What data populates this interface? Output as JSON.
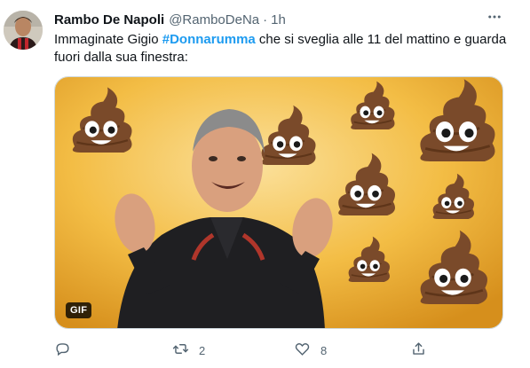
{
  "tweet": {
    "author_name": "Rambo De Napoli",
    "handle": "@RamboDeNa",
    "separator": "·",
    "time": "1h",
    "text_part1": "Immaginate Gigio ",
    "hashtag": "#Donnarumma",
    "text_part2": " che si sveglia alle 11 del mattino e guarda fuori dalla sua finestra:",
    "media_badge": "GIF"
  },
  "actions": {
    "reply_count": "",
    "retweet_count": "2",
    "like_count": "8"
  },
  "icons": {
    "more": "more-horizontal-icon",
    "reply": "reply-icon",
    "retweet": "retweet-icon",
    "like": "heart-icon",
    "share": "share-icon"
  },
  "colors": {
    "text": "#0f1419",
    "secondary": "#536471",
    "link": "#1d9bf0",
    "gif_background": "#f2b83b"
  }
}
